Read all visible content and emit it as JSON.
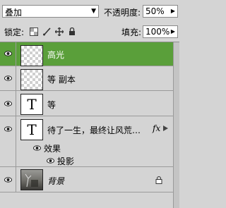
{
  "toolbar": {
    "blend_mode": "叠加",
    "opacity_label": "不透明度:",
    "opacity_value": "50%",
    "lock_label": "锁定:",
    "fill_label": "填充:",
    "fill_value": "100%"
  },
  "layers": [
    {
      "name": "高光",
      "thumb": "transparent",
      "selected": true
    },
    {
      "name": "等 副本",
      "thumb": "transparent",
      "selected": false
    },
    {
      "name": "等",
      "thumb": "text",
      "thumb_glyph": "T",
      "selected": false
    },
    {
      "name": "待了一生，最终让风荒…",
      "thumb": "text",
      "thumb_glyph": "T",
      "fx": "fx",
      "selected": false
    },
    {
      "name": "背景",
      "thumb": "photo",
      "locked": true,
      "selected": false
    }
  ],
  "effects": {
    "label": "效果",
    "items": [
      "投影"
    ]
  },
  "colors": {
    "selected_row": "#5a9f3a",
    "panel_bg": "#d4d4d4"
  }
}
